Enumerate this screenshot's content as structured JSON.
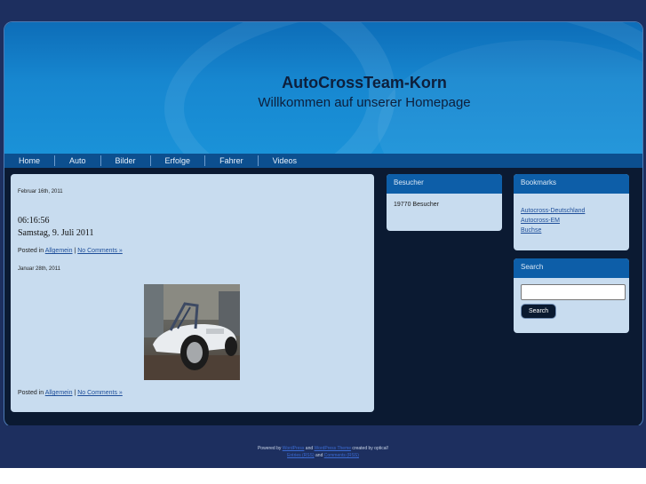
{
  "header": {
    "title": "AutoCrossTeam-Korn",
    "subtitle": "Willkommen auf unserer Homepage"
  },
  "nav": {
    "items": [
      "Home",
      "Auto",
      "Bilder",
      "Erfolge",
      "Fahrer",
      "Videos"
    ]
  },
  "posts": [
    {
      "date": "Februar 16th, 2011",
      "time": "06:16:56",
      "day": "Samstag, 9. Juli 2011",
      "posted_in": "Posted in",
      "category": "Allgemein",
      "separator": "|",
      "comments": "No Comments »"
    },
    {
      "date": "Januar 28th, 2011",
      "posted_in": "Posted in",
      "category": "Allgemein",
      "separator": "|",
      "comments": "No Comments »"
    }
  ],
  "besucher": {
    "title": "Besucher",
    "text": "19770 Besucher"
  },
  "bookmarks": {
    "title": "Bookmarks",
    "links": [
      "Autocross-Deutschland",
      "Autocross-EM",
      "Buchse"
    ]
  },
  "search": {
    "title": "Search",
    "input_value": "",
    "button": "Search"
  },
  "footer": {
    "powered_by": "Powered by",
    "wordpress": "WordPress",
    "and1": "and",
    "theme": "WordPress Theme",
    "created_by": "created by optical!",
    "entries": "Entries (RSS)",
    "and2": "and",
    "comments_rss": "Comments (RSS)"
  }
}
